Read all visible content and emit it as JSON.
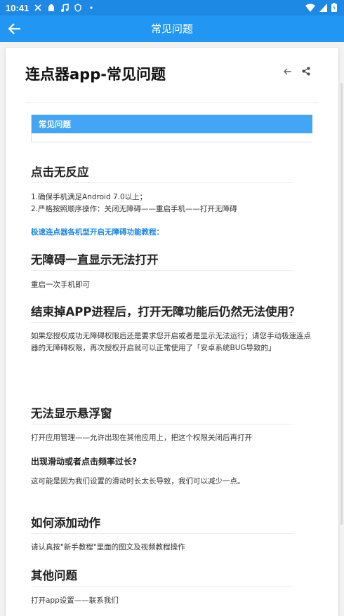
{
  "status_bar": {
    "time": "10:41",
    "icons": [
      "notification-icon",
      "android-icon",
      "music-icon",
      "shield-icon",
      "dot-icon",
      "wifi-icon",
      "signal-icon",
      "battery-icon"
    ]
  },
  "app_bar": {
    "title": "常见问题",
    "back_icon": "arrow-left-icon"
  },
  "article": {
    "title": "连点器app-常见问题",
    "title_actions": [
      "arrow-left-icon",
      "share-icon"
    ],
    "banner_label": "常见问题",
    "sections": {
      "no_response": {
        "heading": "点击无反应",
        "line1": "1.确保手机满足Android 7.0以上；",
        "line2": "2.严格按照顺序操作：关闭无障碍——重启手机——打开无障碍",
        "link": "极速连点器各机型开启无障碍功能教程："
      },
      "accessibility_stuck": {
        "heading": "无障碍一直显示无法打开",
        "text": "重启一次手机即可"
      },
      "process_killed": {
        "heading": "结束掉APP进程后，打开无障功能后仍然无法使用？",
        "text": "如果您授权成功无障碍权限后还是要求您开启或者是显示无法运行；请您手动极速连点器的无障碍权限，再次授权开启就可以正常使用了「安卓系统BUG导致的」"
      },
      "float_window": {
        "heading": "无法显示悬浮窗",
        "text": "打开应用管理——允许出现在其他应用上，把这个权限关闭后再打开",
        "subheading": "出现滑动或者点击频率过长?",
        "subtext": "这可能是因为我们设置的滑动时长太长导致，我们可以减少一点。"
      },
      "add_action": {
        "heading": "如何添加动作",
        "text": "请认真按\"新手教程\"里面的图文及视频教程操作"
      },
      "other": {
        "heading": "其他问题",
        "text": "打开app设置——联系我们"
      }
    }
  },
  "colors": {
    "status_bar": "#1e88e5",
    "app_bar": "#2196f3",
    "banner": "#42a5f5",
    "link": "#1e88e5"
  }
}
